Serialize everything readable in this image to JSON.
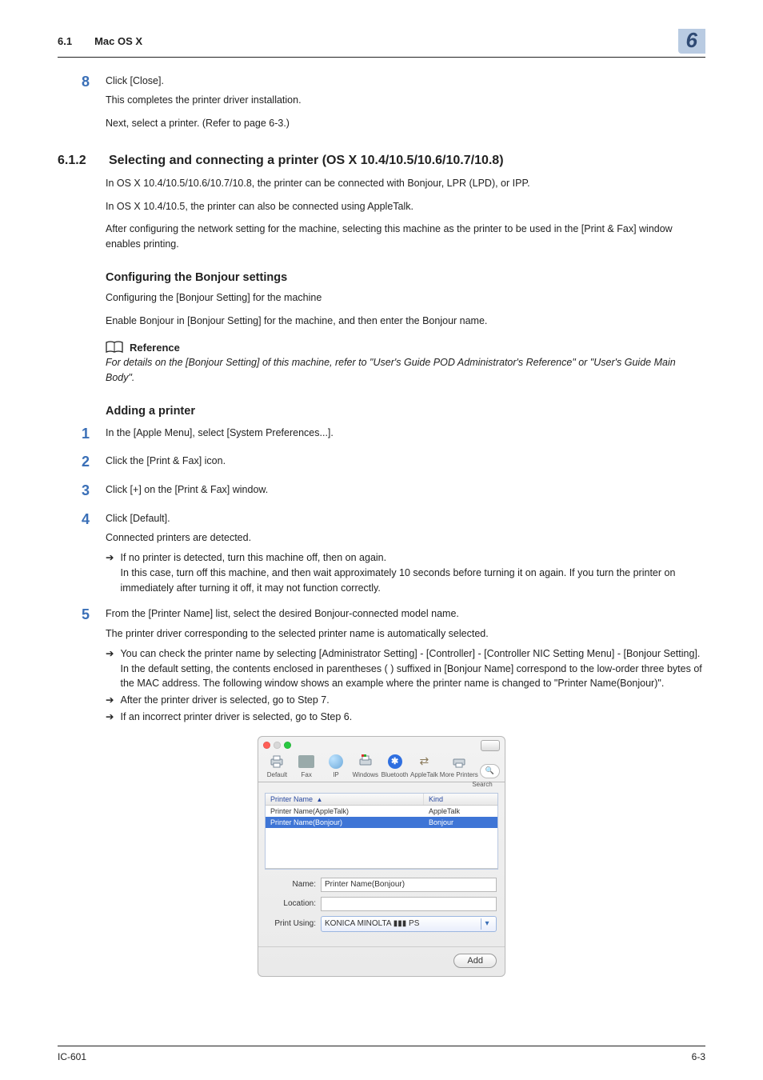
{
  "header": {
    "section_num": "6.1",
    "section_title": "Mac OS X",
    "chapter_badge": "6"
  },
  "step8": {
    "num": "8",
    "line1": "Click [Close].",
    "line2": "This completes the printer driver installation."
  },
  "after8": "Next, select a printer. (Refer to page 6-3.)",
  "sec612": {
    "num": "6.1.2",
    "title": "Selecting and connecting a printer (OS X 10.4/10.5/10.6/10.7/10.8)",
    "p1": "In OS X 10.4/10.5/10.6/10.7/10.8, the printer can be connected with Bonjour, LPR (LPD), or IPP.",
    "p2": "In OS X 10.4/10.5, the printer can also be connected using AppleTalk.",
    "p3": "After configuring the network setting for the machine, selecting this machine as the printer to be used in the [Print & Fax] window enables printing."
  },
  "bonjour": {
    "title": "Configuring the Bonjour settings",
    "p1": "Configuring the [Bonjour Setting] for the machine",
    "p2": "Enable Bonjour in [Bonjour Setting] for the machine, and then enter the Bonjour name."
  },
  "reference": {
    "label": "Reference",
    "text": "For details on the [Bonjour Setting] of this machine, refer to \"User's Guide POD Administrator's Reference\" or \"User's Guide Main Body\"."
  },
  "adding": {
    "title": "Adding a printer",
    "steps": {
      "s1": {
        "num": "1",
        "text": "In the [Apple Menu], select [System Preferences...]."
      },
      "s2": {
        "num": "2",
        "text": "Click the [Print & Fax] icon."
      },
      "s3": {
        "num": "3",
        "text": "Click [+] on the [Print & Fax] window."
      },
      "s4": {
        "num": "4",
        "text": "Click [Default].",
        "sub1": "Connected printers are detected.",
        "b1": "If no printer is detected, turn this machine off, then on again.",
        "b1b": "In this case, turn off this machine, and then wait approximately 10 seconds before turning it on again. If you turn the printer on immediately after turning it off, it may not function correctly."
      },
      "s5": {
        "num": "5",
        "text": "From the [Printer Name] list, select the desired Bonjour-connected model name.",
        "sub1": "The printer driver corresponding to the selected printer name is automatically selected.",
        "b1": "You can check the printer name by selecting [Administrator Setting] - [Controller] - [Controller NIC Setting Menu] - [Bonjour Setting]. In the default setting, the contents enclosed in parentheses ( ) suffixed in [Bonjour Name] correspond to the low-order three bytes of the MAC address. The following window shows an example where the printer name is changed to \"Printer Name(Bonjour)\".",
        "b2": "After the printer driver is selected, go to Step 7.",
        "b3": "If an incorrect printer driver is selected, go to Step 6."
      }
    }
  },
  "mac_dialog": {
    "toolbar": {
      "default": "Default",
      "fax": "Fax",
      "ip": "IP",
      "windows": "Windows",
      "bluetooth": "Bluetooth",
      "appletalk": "AppleTalk",
      "more": "More Printers",
      "search": "Search"
    },
    "columns": {
      "name": "Printer Name",
      "kind": "Kind"
    },
    "rows": [
      {
        "name": "Printer Name(AppleTalk)",
        "kind": "AppleTalk",
        "selected": false
      },
      {
        "name": "Printer Name(Bonjour)",
        "kind": "Bonjour",
        "selected": true
      }
    ],
    "form": {
      "name_label": "Name:",
      "name_value": "Printer Name(Bonjour)",
      "location_label": "Location:",
      "location_value": "",
      "printusing_label": "Print Using:",
      "printusing_value": "KONICA MINOLTA ▮▮▮ PS"
    },
    "add_button": "Add"
  },
  "footer": {
    "left": "IC-601",
    "right": "6-3"
  }
}
